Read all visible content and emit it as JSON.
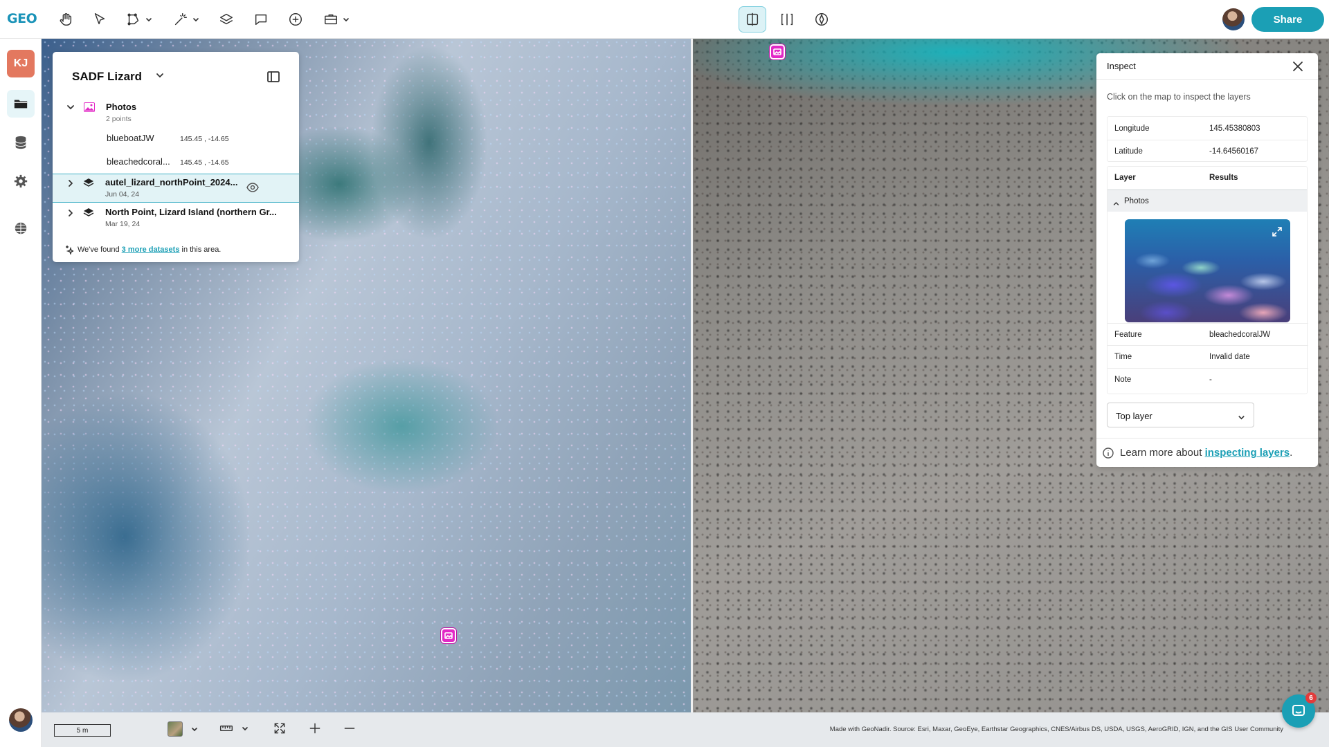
{
  "app": {
    "logo": "GEO"
  },
  "toolbar": {
    "tools": [
      "hand-icon",
      "pointer-icon",
      "polygon-icon",
      "magic-wand-icon",
      "layer-stack-icon",
      "comment-icon",
      "add-circle-icon",
      "toolbox-icon"
    ],
    "share_label": "Share"
  },
  "sidebar": {
    "user_initials": "KJ",
    "items": [
      "folder-icon",
      "database-icon",
      "settings-icon",
      "grid-icon"
    ]
  },
  "project": {
    "title": "SADF Lizard",
    "layers": [
      {
        "name": "Photos",
        "meta": "2 points",
        "points": [
          {
            "name": "blueboatJW",
            "coords": "145.45 , -14.65"
          },
          {
            "name": "bleachedcoral...",
            "coords": "145.45 , -14.65"
          }
        ]
      },
      {
        "name": "autel_lizard_northPoint_2024...",
        "date": "Jun 04, 24"
      },
      {
        "name": "North Point, Lizard Island (northern Gr...",
        "date": "Mar 19, 24"
      }
    ],
    "found_prefix": "We've found",
    "found_link": "3 more datasets",
    "found_suffix": "in this area."
  },
  "inspect": {
    "title": "Inspect",
    "hint": "Click on the map to inspect the layers",
    "longitude_label": "Longitude",
    "longitude": "145.45380803",
    "latitude_label": "Latitude",
    "latitude": "-14.64560167",
    "layer_header": "Layer",
    "results_header": "Results",
    "group": "Photos",
    "feature_label": "Feature",
    "feature": "bleachedcoralJW",
    "time_label": "Time",
    "time": "Invalid date",
    "note_label": "Note",
    "note": "-",
    "select_value": "Top layer",
    "learn_prefix": "Learn more about",
    "learn_link": "inspecting layers",
    "learn_suffix": "."
  },
  "map": {
    "scale": "5 m",
    "attribution": "Made with GeoNadir. Source: Esri, Maxar, GeoEye, Earthstar Geographics, CNES/Airbus DS, USDA, USGS, AeroGRID, IGN, and the GIS User Community",
    "chat_badge": "6"
  },
  "colors": {
    "accent": "#1b9fb5",
    "marker": "#e229c6",
    "avatar_bg": "#e3785f"
  }
}
